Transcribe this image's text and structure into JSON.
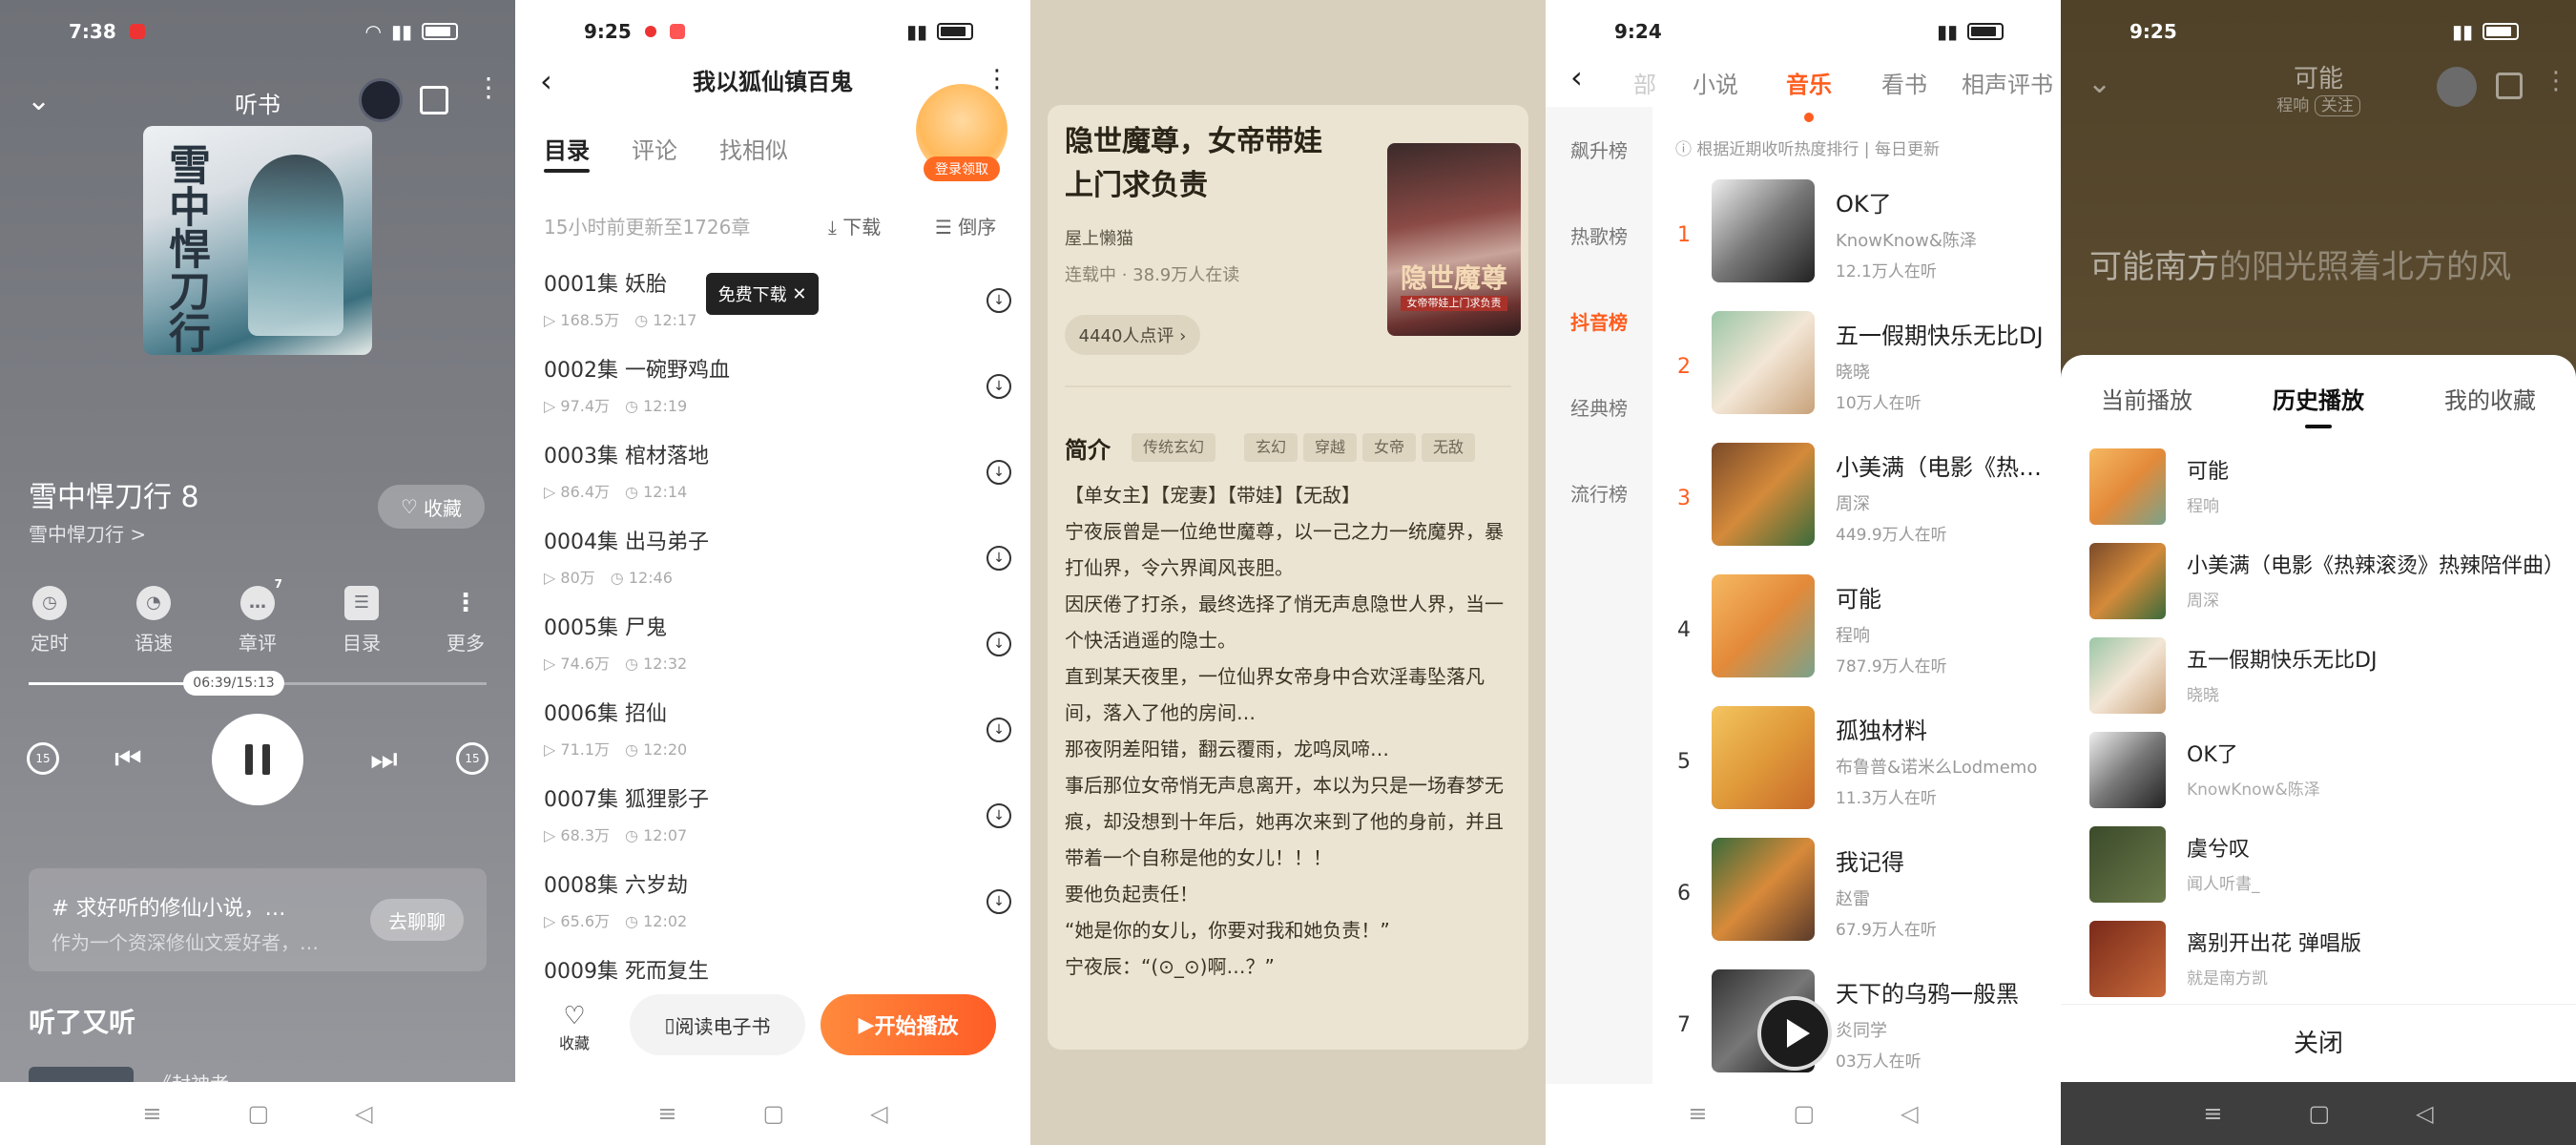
{
  "p1": {
    "status_time": "7:38",
    "header_title": "听书",
    "book_title": "雪中悍刀行 8",
    "book_link": "雪中悍刀行 >",
    "fav_label": "收藏",
    "cover_text": "雪中悍刀行",
    "tools": [
      "定时",
      "语速",
      "章评",
      "目录",
      "更多"
    ],
    "chapter_comment_count": "7",
    "time_label": "06:39/15:13",
    "progress": 0.44,
    "chat_line1": "求好听的修仙小说，…",
    "chat_line2": "作为一个资深修仙文爱好者，…",
    "chat_btn": "去聊聊",
    "section_title": "听了又听",
    "peek_text": "《封神者"
  },
  "p2": {
    "status_time": "9:25",
    "title": "我以狐仙镇百鬼",
    "tabs": [
      "目录",
      "评论",
      "找相似"
    ],
    "gift_label": "登录领取",
    "update_info": "15小时前更新至1726章",
    "download_label": "下载",
    "sort_label": "倒序",
    "free_tip": "免费下载",
    "chapters": [
      {
        "name": "0001集 妖胎",
        "plays": "168.5万",
        "dur": "12:17"
      },
      {
        "name": "0002集 一碗野鸡血",
        "plays": "97.4万",
        "dur": "12:19"
      },
      {
        "name": "0003集 棺材落地",
        "plays": "86.4万",
        "dur": "12:14"
      },
      {
        "name": "0004集 出马弟子",
        "plays": "80万",
        "dur": "12:46"
      },
      {
        "name": "0005集 尸鬼",
        "plays": "74.6万",
        "dur": "12:32"
      },
      {
        "name": "0006集 招仙",
        "plays": "71.1万",
        "dur": "12:20"
      },
      {
        "name": "0007集 狐狸影子",
        "plays": "68.3万",
        "dur": "12:07"
      },
      {
        "name": "0008集 六岁劫",
        "plays": "65.6万",
        "dur": "12:02"
      },
      {
        "name": "0009集 死而复生",
        "plays": "",
        "dur": ""
      }
    ],
    "bottom_fav": "收藏",
    "read_btn": "阅读电子书",
    "play_btn": "开始播放"
  },
  "p3": {
    "title": "隐世魔尊，女帝带娃上门求负责",
    "author": "屋上懒猫",
    "stat": "连载中 · 38.9万人在读",
    "comment_pill": "4440人点评 ›",
    "cover_title": "隐世魔尊",
    "cover_sub": "女帝带娃上门求负责",
    "intro_label": "简介",
    "tags": [
      "传统玄幻",
      "玄幻",
      "穿越",
      "女帝",
      "无敌"
    ],
    "body": [
      "【单女主】【宠妻】【带娃】【无敌】",
      "宁夜辰曾是一位绝世魔尊，以一己之力一统魔界，暴打仙界，令六界闻风丧胆。",
      "因厌倦了打杀，最终选择了悄无声息隐世人界，当一个快活逍遥的隐士。",
      "直到某天夜里，一位仙界女帝身中合欢淫毒坠落凡间，落入了他的房间…",
      "那夜阴差阳错，翻云覆雨，龙鸣凤啼…",
      "事后那位女帝悄无声息离开，本以为只是一场春梦无痕，却没想到十年后，她再次来到了他的身前，并且带着一个自称是他的女儿！！！",
      "要他负起责任！",
      "“她是你的女儿，你要对我和她负责！”",
      "宁夜辰：“(⊙_⊙)啊…？”"
    ]
  },
  "p4": {
    "status_time": "9:24",
    "tabs": [
      "部",
      "小说",
      "音乐",
      "看书",
      "相声评书"
    ],
    "side": [
      "飙升榜",
      "热歌榜",
      "抖音榜",
      "经典榜",
      "流行榜"
    ],
    "note": "根据近期收听热度排行 | 每日更新",
    "songs": [
      {
        "rank": "1",
        "name": "OK了",
        "artist": "KnowKnow&陈泽",
        "listen": "12.1万人在听"
      },
      {
        "rank": "2",
        "name": "五一假期快乐无比DJ",
        "artist": "晓晓",
        "listen": "10万人在听"
      },
      {
        "rank": "3",
        "name": "小美满（电影《热辣滚烫》热辣陪伴曲）",
        "artist": "周深",
        "listen": "449.9万人在听"
      },
      {
        "rank": "4",
        "name": "可能",
        "artist": "程响",
        "listen": "787.9万人在听"
      },
      {
        "rank": "5",
        "name": "孤独材料",
        "artist": "布鲁普&诺米么Lodmemo",
        "listen": "11.3万人在听"
      },
      {
        "rank": "6",
        "name": "我记得",
        "artist": "赵雷",
        "listen": "67.9万人在听"
      },
      {
        "rank": "7",
        "name": "天下的乌鸦一般黑",
        "artist": "炎同学",
        "listen": "03万人在听"
      }
    ]
  },
  "p5": {
    "status_time": "9:25",
    "song": "可能",
    "artist": "程响",
    "follow": "关注",
    "lyric_a": "可能南方",
    "lyric_b": "的阳光照着北方的风",
    "tabs": [
      "当前播放",
      "历史播放",
      "我的收藏"
    ],
    "history": [
      {
        "name": "可能",
        "artist": "程响"
      },
      {
        "name": "小美满（电影《热辣滚烫》热辣陪伴曲）",
        "artist": "周深"
      },
      {
        "name": "五一假期快乐无比DJ",
        "artist": "晓晓"
      },
      {
        "name": "OK了",
        "artist": "KnowKnow&陈泽"
      },
      {
        "name": "虞兮叹",
        "artist": "闻人听書_"
      },
      {
        "name": "离别开出花 弹唱版",
        "artist": "就是南方凯"
      }
    ],
    "close": "关闭"
  },
  "colors": {
    "accent": "#ff5d1f",
    "play_gradient_start": "#ff8a3d"
  }
}
